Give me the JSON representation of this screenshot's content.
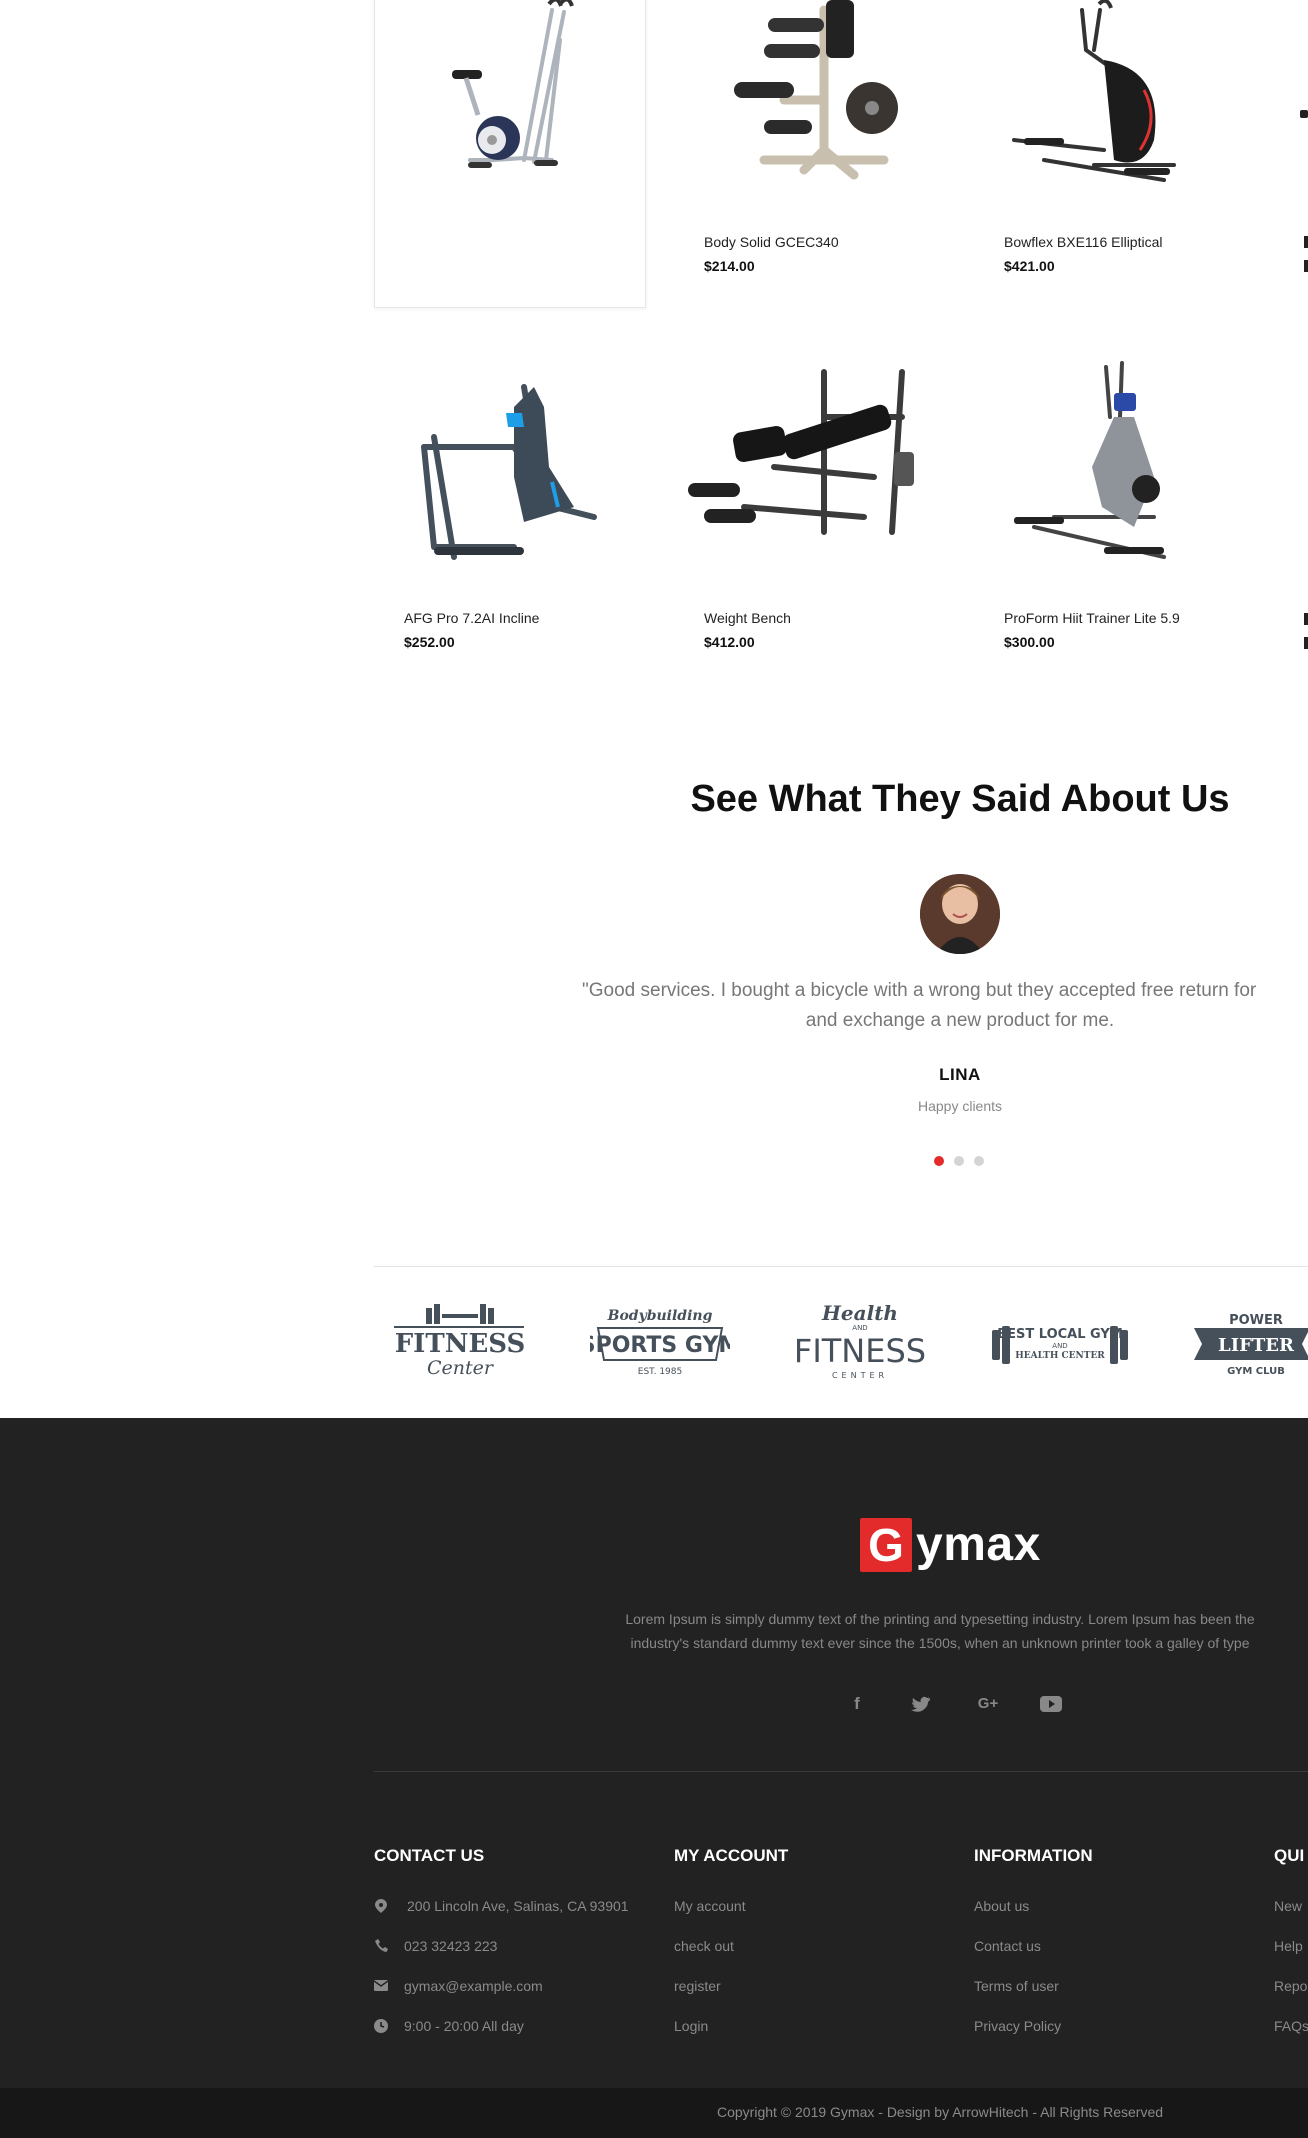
{
  "products": [
    {
      "name": "",
      "price": ""
    },
    {
      "name": "Body Solid GCEC340",
      "price": "$214.00"
    },
    {
      "name": "Bowflex BXE116 Elliptical",
      "price": "$421.00"
    },
    {
      "name": "AFG Pro 7.2AI Incline",
      "price": "$252.00"
    },
    {
      "name": "Weight Bench",
      "price": "$412.00"
    },
    {
      "name": "ProForm Hiit Trainer Lite 5.9",
      "price": "$300.00"
    }
  ],
  "testimonials": {
    "title": "See What They Said About Us",
    "quote_line1": "\"Good services. I bought a bicycle with a wrong but they accepted free return for",
    "quote_line2": "and exchange a new product for me.",
    "name": "LINA",
    "role": "Happy clients",
    "active_dot": 0,
    "dot_count": 3
  },
  "brands": [
    {
      "top": "",
      "main": "FITNESS",
      "sub": "Center"
    },
    {
      "top": "Bodybuilding",
      "main": "SPORTS GYM",
      "sub": "EST. 1985"
    },
    {
      "top": "Health",
      "mid": "AND",
      "main": "FITNESS",
      "sub": "CENTER"
    },
    {
      "top": "BEST LOCAL GYM",
      "mid": "AND",
      "main": "HEALTH CENTER",
      "sub": ""
    },
    {
      "top": "POWER",
      "main": "LIFTER",
      "sub": "GYM CLUB"
    }
  ],
  "footer": {
    "logo_letter": "G",
    "logo_text": "ymax",
    "about_line1": "Lorem Ipsum is simply dummy text of the printing and typesetting industry. Lorem Ipsum has been the",
    "about_line2": "industry's standard dummy text ever since the 1500s, when an unknown printer took a galley of type",
    "socials": [
      "facebook-icon",
      "twitter-icon",
      "google-plus-icon",
      "youtube-icon"
    ],
    "columns": {
      "contact": {
        "title": "CONTACT US",
        "items": [
          "200 Lincoln Ave, Salinas, CA 93901",
          "023 32423 223",
          "gymax@example.com",
          "9:00 - 20:00 All day"
        ]
      },
      "account": {
        "title": "MY ACCOUNT",
        "items": [
          "My account",
          "check out",
          "register",
          "Login"
        ]
      },
      "information": {
        "title": "INFORMATION",
        "items": [
          "About us",
          "Contact us",
          "Terms of user",
          "Privacy Policy"
        ]
      },
      "quick": {
        "title": "QUI",
        "items": [
          "New",
          "Help",
          "Repo",
          "FAQs"
        ]
      }
    },
    "copyright": "Copyright © 2019 Gymax - Design by ArrowHitech - All Rights Reserved"
  },
  "colors": {
    "accent": "#e32b2b",
    "footer_bg": "#222222",
    "copyright_bg": "#171717",
    "brand_logo": "#46505a"
  }
}
